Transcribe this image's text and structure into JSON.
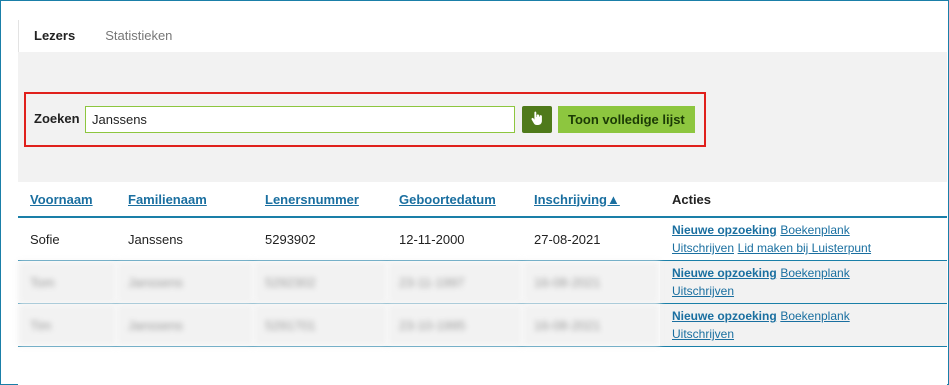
{
  "tabs": [
    "Lezers",
    "Statistieken"
  ],
  "search": {
    "label": "Zoeken",
    "value": "Janssens",
    "icon": "hand-pointer-icon",
    "list_button": "Toon volledige lijst"
  },
  "table": {
    "headers": [
      "Voornaam",
      "Familienaam",
      "Lenersnummer",
      "Geboortedatum",
      "Inschrijving▲",
      "Acties"
    ],
    "rows": [
      {
        "voornaam": "Sofie",
        "familienaam": "Janssens",
        "lenersnummer": "5293902",
        "geboortedatum": "12-11-2000",
        "inschrijving": "27-08-2021",
        "actions": [
          "Nieuwe opzoeking",
          "Boekenplank",
          "Uitschrijven",
          "Lid maken bij Luisterpunt"
        ]
      },
      {
        "voornaam": "Tom",
        "familienaam": "Janssens",
        "lenersnummer": "5292302",
        "geboortedatum": "23-11-1997",
        "inschrijving": "16-08-2021",
        "actions": [
          "Nieuwe opzoeking",
          "Boekenplank",
          "Uitschrijven"
        ]
      },
      {
        "voornaam": "Tim",
        "familienaam": "Janssens",
        "lenersnummer": "5291701",
        "geboortedatum": "23-10-1995",
        "inschrijving": "16-08-2021",
        "actions": [
          "Nieuwe opzoeking",
          "Boekenplank",
          "Uitschrijven"
        ]
      }
    ]
  },
  "colors": {
    "accent": "#1a7fa8",
    "green": "#8dc63f",
    "dark_green": "#4f7a1b",
    "highlight": "#e0201c"
  }
}
